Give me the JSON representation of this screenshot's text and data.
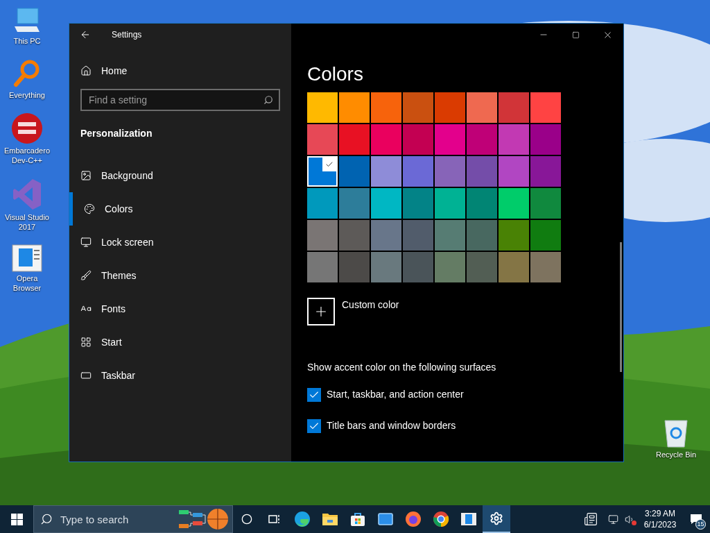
{
  "desktop_icons": [
    {
      "label": "This PC",
      "kind": "pc"
    },
    {
      "label": "Everything",
      "kind": "everything"
    },
    {
      "label": "Embarcadero Dev-C++",
      "kind": "devcpp"
    },
    {
      "label": "Visual Studio 2017",
      "kind": "vs"
    },
    {
      "label": "Opera Browser",
      "kind": "opera"
    }
  ],
  "recycle_bin": {
    "label": "Recycle Bin"
  },
  "window": {
    "title": "Settings",
    "home": "Home",
    "search": {
      "placeholder": "Find a setting"
    },
    "section": "Personalization",
    "nav": [
      {
        "label": "Background",
        "kind": "background",
        "selected": false
      },
      {
        "label": "Colors",
        "kind": "colors",
        "selected": true
      },
      {
        "label": "Lock screen",
        "kind": "lock",
        "selected": false
      },
      {
        "label": "Themes",
        "kind": "themes",
        "selected": false
      },
      {
        "label": "Fonts",
        "kind": "fonts",
        "selected": false
      },
      {
        "label": "Start",
        "kind": "start",
        "selected": false
      },
      {
        "label": "Taskbar",
        "kind": "taskbar",
        "selected": false
      }
    ]
  },
  "content": {
    "heading": "Colors",
    "swatches": [
      {
        "color": "#ffb900",
        "selected": false
      },
      {
        "color": "#ff8c00",
        "selected": false
      },
      {
        "color": "#f7630c",
        "selected": false
      },
      {
        "color": "#ca5010",
        "selected": false
      },
      {
        "color": "#da3b01",
        "selected": false
      },
      {
        "color": "#ef6950",
        "selected": false
      },
      {
        "color": "#d13438",
        "selected": false
      },
      {
        "color": "#ff4343",
        "selected": false
      },
      {
        "color": "#e74856",
        "selected": false
      },
      {
        "color": "#e81123",
        "selected": false
      },
      {
        "color": "#ea005e",
        "selected": false
      },
      {
        "color": "#c30052",
        "selected": false
      },
      {
        "color": "#e3008c",
        "selected": false
      },
      {
        "color": "#bf0077",
        "selected": false
      },
      {
        "color": "#c239b3",
        "selected": false
      },
      {
        "color": "#9a0089",
        "selected": false
      },
      {
        "color": "#0078d7",
        "selected": true
      },
      {
        "color": "#0063b1",
        "selected": false
      },
      {
        "color": "#8e8cd8",
        "selected": false
      },
      {
        "color": "#6b69d6",
        "selected": false
      },
      {
        "color": "#8764b8",
        "selected": false
      },
      {
        "color": "#744da9",
        "selected": false
      },
      {
        "color": "#b146c2",
        "selected": false
      },
      {
        "color": "#881798",
        "selected": false
      },
      {
        "color": "#0099bc",
        "selected": false
      },
      {
        "color": "#2d7d9a",
        "selected": false
      },
      {
        "color": "#00b7c3",
        "selected": false
      },
      {
        "color": "#038387",
        "selected": false
      },
      {
        "color": "#00b294",
        "selected": false
      },
      {
        "color": "#018574",
        "selected": false
      },
      {
        "color": "#00cc6a",
        "selected": false
      },
      {
        "color": "#10893e",
        "selected": false
      },
      {
        "color": "#7a7574",
        "selected": false
      },
      {
        "color": "#5d5a58",
        "selected": false
      },
      {
        "color": "#68768a",
        "selected": false
      },
      {
        "color": "#515c6b",
        "selected": false
      },
      {
        "color": "#567c73",
        "selected": false
      },
      {
        "color": "#486860",
        "selected": false
      },
      {
        "color": "#498205",
        "selected": false
      },
      {
        "color": "#107c10",
        "selected": false
      },
      {
        "color": "#767676",
        "selected": false
      },
      {
        "color": "#4c4a48",
        "selected": false
      },
      {
        "color": "#69797e",
        "selected": false
      },
      {
        "color": "#4a5459",
        "selected": false
      },
      {
        "color": "#647c64",
        "selected": false
      },
      {
        "color": "#525e54",
        "selected": false
      },
      {
        "color": "#847545",
        "selected": false
      },
      {
        "color": "#7e735f",
        "selected": false
      }
    ],
    "custom_color": "Custom color",
    "surfaces_label": "Show accent color on the following surfaces",
    "options": [
      {
        "label": "Start, taskbar, and action center",
        "checked": true
      },
      {
        "label": "Title bars and window borders",
        "checked": true
      }
    ]
  },
  "taskbar": {
    "search_placeholder": "Type to search",
    "apps": [
      {
        "kind": "cortana",
        "active": false
      },
      {
        "kind": "taskview",
        "active": false
      },
      {
        "kind": "edge",
        "active": false
      },
      {
        "kind": "explorer",
        "active": false
      },
      {
        "kind": "store",
        "active": false
      },
      {
        "kind": "mail",
        "active": false
      },
      {
        "kind": "firefox",
        "active": false
      },
      {
        "kind": "chrome",
        "active": false
      },
      {
        "kind": "app",
        "active": false
      },
      {
        "kind": "settings",
        "active": true
      }
    ],
    "time": "3:29 AM",
    "date": "6/1/2023",
    "notifications": "15"
  }
}
